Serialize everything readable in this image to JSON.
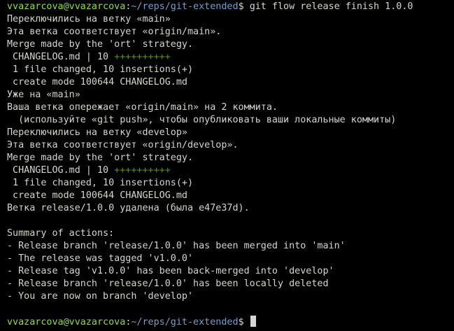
{
  "prompt": {
    "user_host": "vvazarcova@vvazarcova",
    "separator": ":",
    "path": "~/reps/git-extended",
    "symbol": "$ "
  },
  "command": "git flow release finish 1.0.0",
  "output": {
    "line1": "Переключились на ветку «main»",
    "line2": "Эта ветка соответствует «origin/main».",
    "line3": "Merge made by the 'ort' strategy.",
    "line4_file": " CHANGELOG.md | 10 ",
    "line4_plus": "++++++++++",
    "line5": " 1 file changed, 10 insertions(+)",
    "line6": " create mode 100644 CHANGELOG.md",
    "line7": "Уже на «main»",
    "line8": "Ваша ветка опережает «origin/main» на 2 коммита.",
    "line9": "  (используйте «git push», чтобы опубликовать ваши локальные коммиты)",
    "line10": "Переключились на ветку «develop»",
    "line11": "Эта ветка соответствует «origin/develop».",
    "line12": "Merge made by the 'ort' strategy.",
    "line13_file": " CHANGELOG.md | 10 ",
    "line13_plus": "++++++++++",
    "line14": " 1 file changed, 10 insertions(+)",
    "line15": " create mode 100644 CHANGELOG.md",
    "line16": "Ветка release/1.0.0 удалена (была e47e37d).",
    "summary_header": "Summary of actions:",
    "summary1": "- Release branch 'release/1.0.0' has been merged into 'main'",
    "summary2": "- The release was tagged 'v1.0.0'",
    "summary3": "- Release tag 'v1.0.0' has been back-merged into 'develop'",
    "summary4": "- Release branch 'release/1.0.0' has been locally deleted",
    "summary5": "- You are now on branch 'develop'"
  },
  "colors": {
    "background": "#000000",
    "foreground": "#d3d7cf",
    "user_host": "#8ae234",
    "path": "#729fcf",
    "diffstat_plus": "#4e9a06"
  }
}
